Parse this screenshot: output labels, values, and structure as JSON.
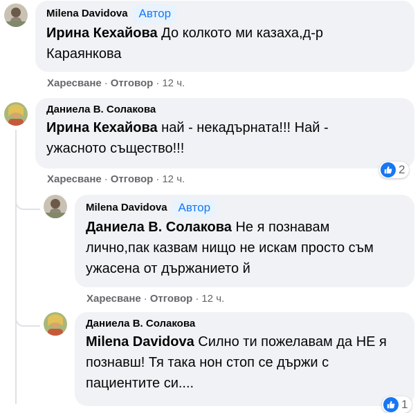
{
  "comments": [
    {
      "author": "Milena Davidova",
      "badge": "Автор",
      "mention": "Ирина Кехайова",
      "text": " До колкото ми казаха,д-р Караянкова",
      "actions": {
        "like": "Харесване",
        "reply": "Отговор",
        "time": "12 ч."
      }
    },
    {
      "author": "Даниела В. Солакова",
      "mention": "Ирина Кехайова",
      "text": " най - некадърната!!! Най - ужасното същество!!!",
      "reaction_count": "2",
      "actions": {
        "like": "Харесване",
        "reply": "Отговор",
        "time": "12 ч."
      }
    },
    {
      "author": "Milena Davidova",
      "badge": "Автор",
      "mention": "Даниела В. Солакова",
      "text": " Не я познавам лично,пак казвам нищо не искам просто съм ужасена от държанието й",
      "actions": {
        "like": "Харесване",
        "reply": "Отговор",
        "time": "12 ч."
      }
    },
    {
      "author": "Даниела В. Солакова",
      "mention": "Milena Davidova",
      "text": " Силно ти пожелавам да НЕ я познавш! Тя така нон стоп се държи с пациентите си....",
      "reaction_count": "1"
    }
  ],
  "separator": "·",
  "colors": {
    "bubble": "#f0f2f5",
    "badge_bg": "#e7f3ff",
    "badge_text": "#1877f2",
    "like_blue": "#1877f2",
    "meta": "#65676b"
  },
  "icons": {
    "like": "thumbs-up-icon"
  }
}
